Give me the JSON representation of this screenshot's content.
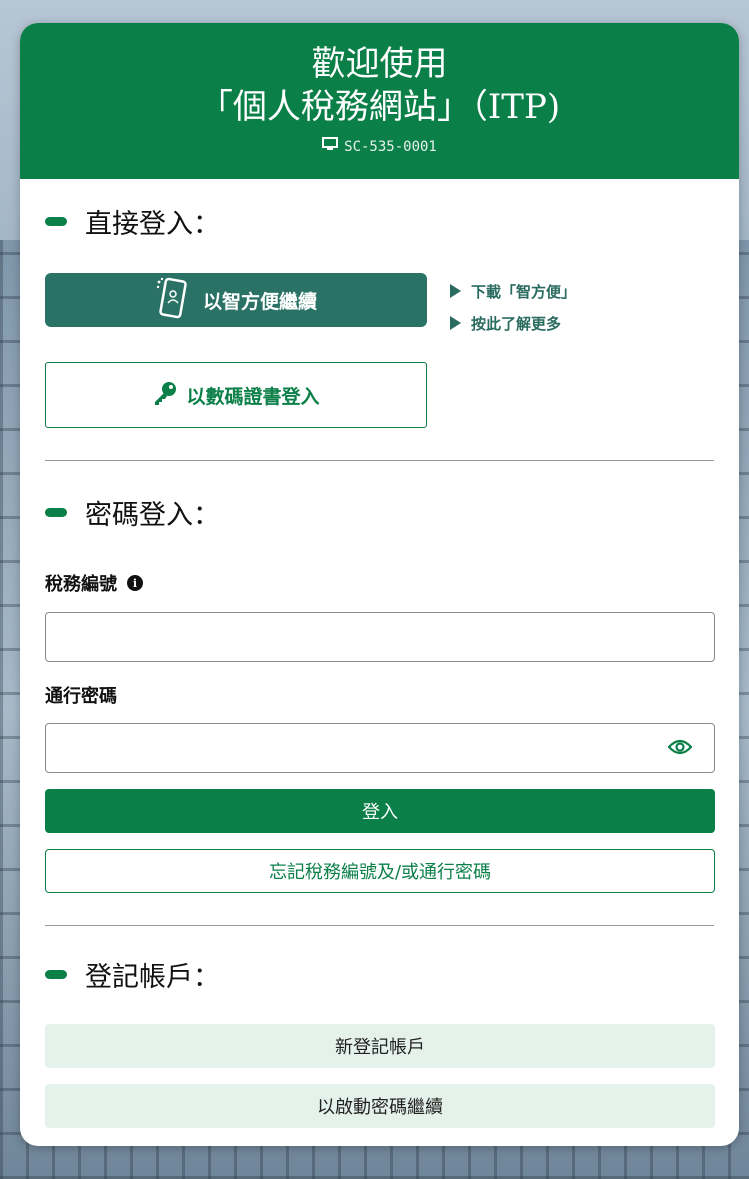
{
  "header": {
    "line1": "歡迎使用",
    "line2": "「個人稅務網站」（ITP)",
    "code": "SC-535-0001"
  },
  "direct_login": {
    "title": "直接登入：",
    "iam_button": "以智方便繼續",
    "download_link": "下載「智方便」",
    "more_link": "按此了解更多",
    "cert_button": "以數碼證書登入"
  },
  "password_login": {
    "title": "密碼登入：",
    "tax_no_label": "稅務編號",
    "password_label": "通行密碼",
    "login_button": "登入",
    "forgot_button": "忘記稅務編號及/或通行密碼"
  },
  "register": {
    "title": "登記帳戶：",
    "new_account_button": "新登記帳戶",
    "activation_button": "以啟動密碼繼續"
  },
  "colors": {
    "brand_green": "#0b7f48",
    "iam_teal": "#2a7265",
    "light_green": "#e5f1eb"
  },
  "icons": {
    "monitor": "monitor-icon",
    "phone": "smartphone-icon",
    "key": "key-icon",
    "info": "info-icon",
    "eye": "eye-icon"
  }
}
